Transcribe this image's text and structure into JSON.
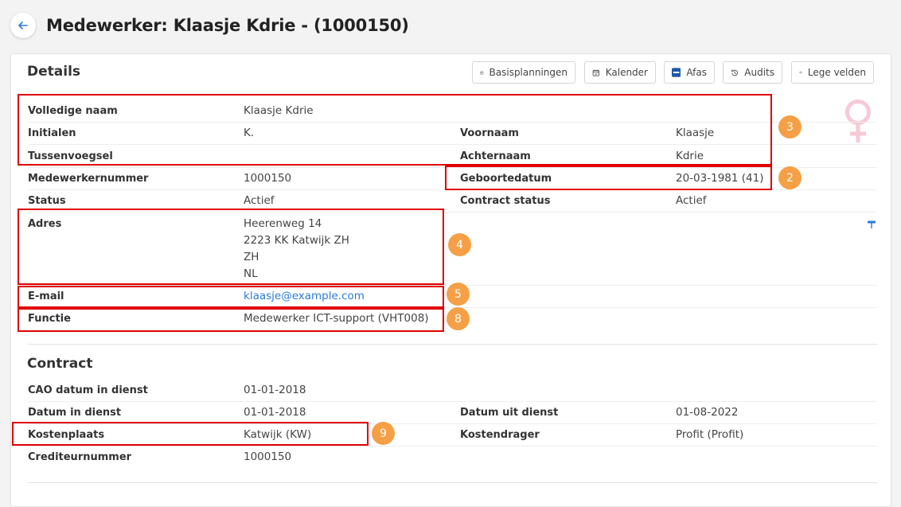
{
  "header": {
    "title": "Medewerker: Klaasje Kdrie - (1000150)"
  },
  "details": {
    "title": "Details",
    "toolbar": {
      "basisplanningen": "Basisplanningen",
      "kalender": "Kalender",
      "afas": "Afas",
      "audits": "Audits",
      "lege_velden": "Lege velden"
    },
    "volledige_naam": {
      "label": "Volledige naam",
      "value": "Klaasje Kdrie"
    },
    "initialen": {
      "label": "Initialen",
      "value": "K."
    },
    "voornaam": {
      "label": "Voornaam",
      "value": "Klaasje"
    },
    "tussenvoegsel": {
      "label": "Tussenvoegsel",
      "value": ""
    },
    "achternaam": {
      "label": "Achternaam",
      "value": "Kdrie"
    },
    "medewerkernummer": {
      "label": "Medewerkernummer",
      "value": "1000150"
    },
    "geboortedatum": {
      "label": "Geboortedatum",
      "value": "20-03-1981 (41)"
    },
    "status": {
      "label": "Status",
      "value": "Actief"
    },
    "contract_status": {
      "label": "Contract status",
      "value": "Actief"
    },
    "adres": {
      "label": "Adres",
      "lines": [
        "Heerenweg 14",
        "2223 KK Katwijk ZH",
        "ZH",
        "NL"
      ]
    },
    "email": {
      "label": "E-mail",
      "value": "klaasje@example.com"
    },
    "functie": {
      "label": "Functie",
      "value": "Medewerker ICT-support (VHT008)"
    }
  },
  "contract": {
    "title": "Contract",
    "cao_datum": {
      "label": "CAO datum in dienst",
      "value": "01-01-2018"
    },
    "datum_in_dienst": {
      "label": "Datum in dienst",
      "value": "01-01-2018"
    },
    "datum_uit_dienst": {
      "label": "Datum uit dienst",
      "value": "01-08-2022"
    },
    "kostenplaats": {
      "label": "Kostenplaats",
      "value": "Katwijk (KW)"
    },
    "kostendrager": {
      "label": "Kostendrager",
      "value": "Profit (Profit)"
    },
    "crediteurnummer": {
      "label": "Crediteurnummer",
      "value": "1000150"
    }
  },
  "annotations": {
    "b3": "3",
    "b2": "2",
    "b4": "4",
    "b5": "5",
    "b8": "8",
    "b9": "9"
  },
  "colors": {
    "highlight": "#e00000",
    "badge": "#f5a046",
    "link": "#2b7bd6",
    "gender": "#f7c9d6"
  },
  "icons": {
    "back": "arrow-left-icon",
    "calendar": "calendar-icon",
    "afas": "afas-logo-icon",
    "audits": "history-icon",
    "eye": "eye-icon",
    "gender": "female-symbol-icon",
    "map": "map-pin-icon"
  }
}
